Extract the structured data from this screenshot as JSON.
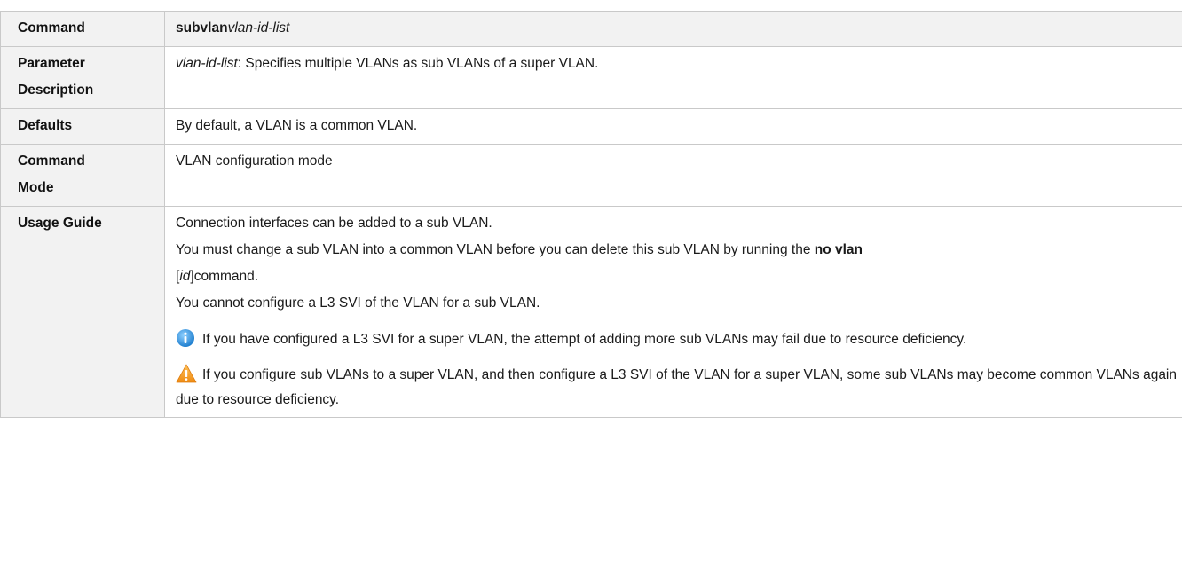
{
  "rows": {
    "command": {
      "label": "Command",
      "cmd_bold": "subvlan",
      "cmd_italic": "vlan-id-list"
    },
    "parameter": {
      "label_line1": "Parameter",
      "label_line2": "Description",
      "param_italic": "vlan-id-list",
      "param_text": ": Specifies multiple VLANs as sub VLANs of a super VLAN."
    },
    "defaults": {
      "label": "Defaults",
      "text": "By default, a VLAN is a common VLAN."
    },
    "mode": {
      "label_line1": "Command",
      "label_line2": "Mode",
      "text": "VLAN configuration mode"
    },
    "usage": {
      "label": "Usage Guide",
      "p1": "Connection interfaces can be added to a sub VLAN.",
      "p2_text": "You must change a sub VLAN into a common VLAN before you can delete this sub VLAN by running the ",
      "p2_bold": "no vlan",
      "p3_open": "[",
      "p3_italic": "id",
      "p3_close": "]command.",
      "p4": "You cannot configure a L3 SVI of the VLAN for a sub VLAN.",
      "note_info": "If you have configured a L3 SVI for a super VLAN, the attempt of adding more sub VLANs may fail due to resource deficiency.",
      "note_warning": "If you configure sub VLANs to a super VLAN, and then configure a L3 SVI of the VLAN for a super VLAN, some sub VLANs may become common VLANs again due to resource deficiency."
    }
  },
  "icons": {
    "info": "info-icon",
    "warning": "warning-icon"
  },
  "colors": {
    "info_icon": "#2f8fd6",
    "warning_icon": "#f29a21",
    "label_bg": "#f2f2f2",
    "border": "#c9c9c9"
  }
}
